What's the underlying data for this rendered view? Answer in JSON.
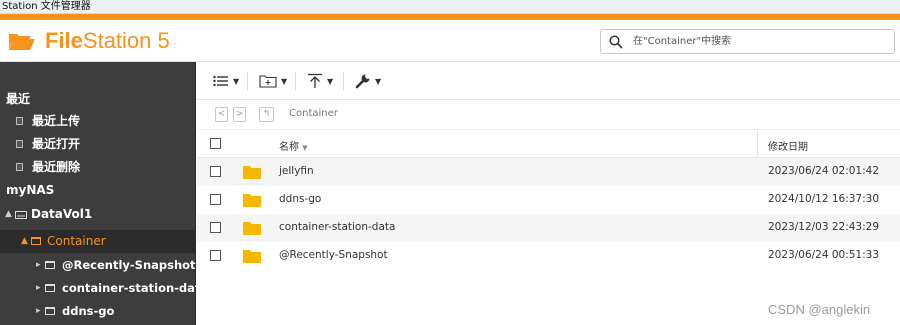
{
  "window": {
    "title": "Station 文件管理器"
  },
  "header": {
    "app_name_bold": "File",
    "app_name_rest": "Station 5",
    "search_placeholder": "在\"Container\"中搜索"
  },
  "sidebar": {
    "recent_heading": "最近",
    "recent_items": [
      {
        "label": "最近上传"
      },
      {
        "label": "最近打开"
      },
      {
        "label": "最近删除"
      }
    ],
    "nas_heading": "myNAS",
    "volume": {
      "label": "DataVol1"
    },
    "selected_folder": {
      "label": "Container"
    },
    "subfolders": [
      {
        "label": "@Recently-Snapshot"
      },
      {
        "label": "container-station-data"
      },
      {
        "label": "ddns-go"
      }
    ]
  },
  "path": {
    "current": "Container"
  },
  "table": {
    "columns": {
      "name": "名称",
      "date": "修改日期"
    },
    "rows": [
      {
        "name": "jellyfin",
        "modified": "2023/06/24 02:01:42"
      },
      {
        "name": "ddns-go",
        "modified": "2024/10/12 16:37:30"
      },
      {
        "name": "container-station-data",
        "modified": "2023/12/03 22:43:29"
      },
      {
        "name": "@Recently-Snapshot",
        "modified": "2023/06/24 00:51:33"
      }
    ]
  },
  "watermark": "CSDN @anglekin",
  "colors": {
    "accent": "#f7931e",
    "sidebar_bg": "#3d3d3d",
    "folder": "#f5b800"
  }
}
